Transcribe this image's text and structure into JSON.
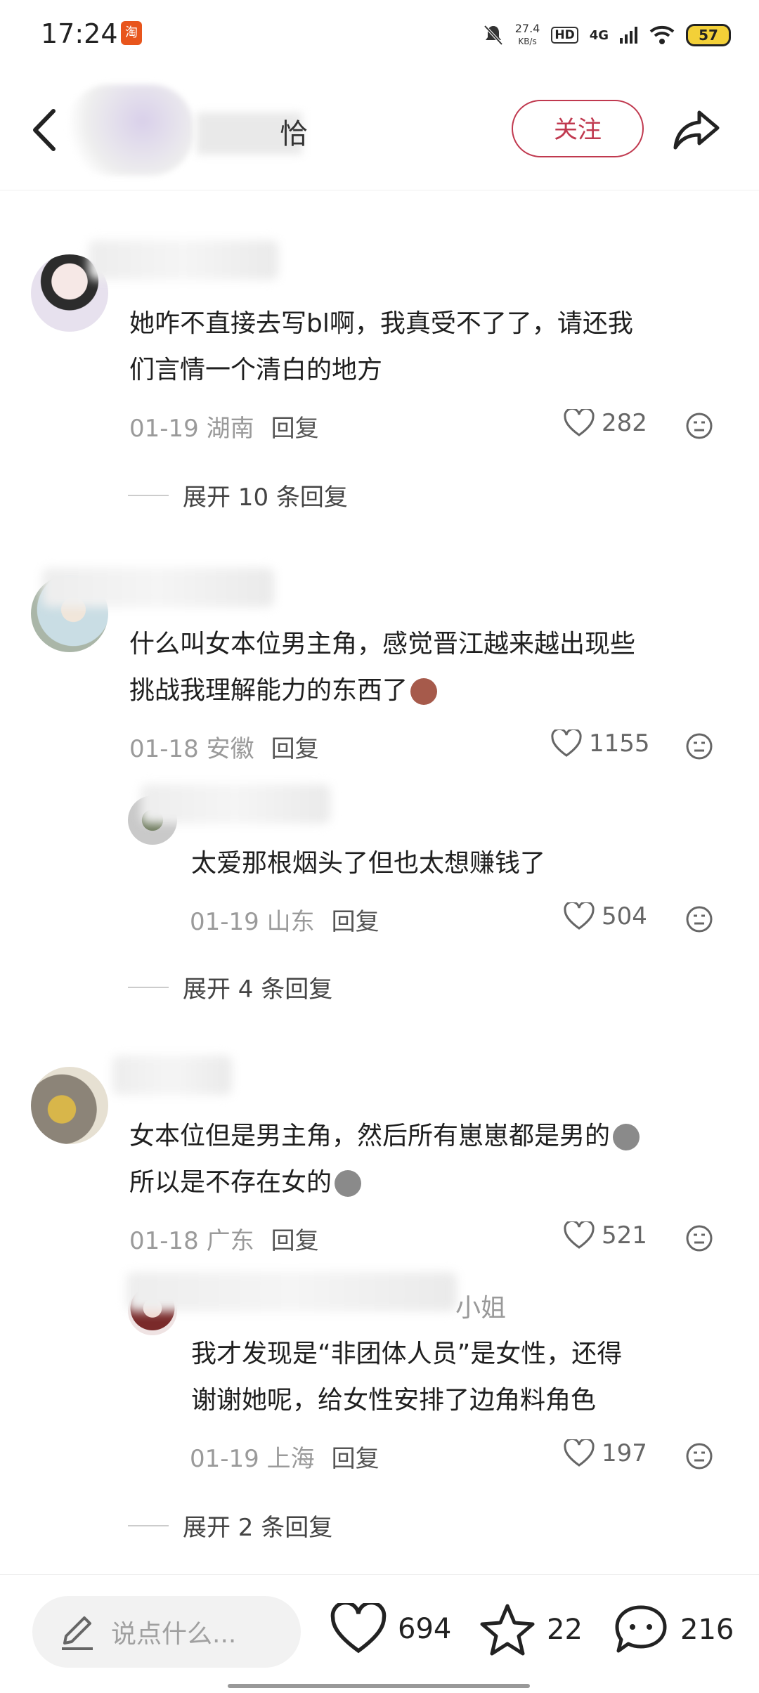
{
  "status_bar": {
    "time": "17:24",
    "app_badge": "淘",
    "net_speed_value": "27.4",
    "net_speed_unit": "KB/s",
    "hd": "HD",
    "network": "4G",
    "battery": "57"
  },
  "header": {
    "follow_label": "关注",
    "name_tail": "恰"
  },
  "comments": [
    {
      "text_line1": "她咋不直接去写bl啊，我真受不了了，请还我",
      "text_line2": "们言情一个清白的地方",
      "date": "01-19",
      "region": "湖南",
      "reply_label": "回复",
      "likes": "282",
      "expand_label": "展开 10 条回复"
    },
    {
      "text_line1": "什么叫女本位男主角，感觉晋江越来越出现些",
      "text_line2": "挑战我理解能力的东西了",
      "date": "01-18",
      "region": "安徽",
      "reply_label": "回复",
      "likes": "1155",
      "reply": {
        "text": "太爱那根烟头了但也太想赚钱了",
        "date": "01-19",
        "region": "山东",
        "reply_label": "回复",
        "likes": "504"
      },
      "expand_label": "展开 4 条回复"
    },
    {
      "text_line1": "女本位但是男主角，然后所有崽崽都是男的",
      "text_line2": "所以是不存在女的",
      "date": "01-18",
      "region": "广东",
      "reply_label": "回复",
      "likes": "521",
      "reply": {
        "name_tail": "小姐",
        "text_line1": "我才发现是“非团体人员”是女性，还得",
        "text_line2": "谢谢她呢，给女性安排了边角料角色",
        "date": "01-19",
        "region": "上海",
        "reply_label": "回复",
        "likes": "197"
      },
      "expand_label": "展开 2 条回复"
    }
  ],
  "bottom_bar": {
    "input_placeholder": "说点什么...",
    "likes": "694",
    "favorites": "22",
    "comments": "216"
  }
}
